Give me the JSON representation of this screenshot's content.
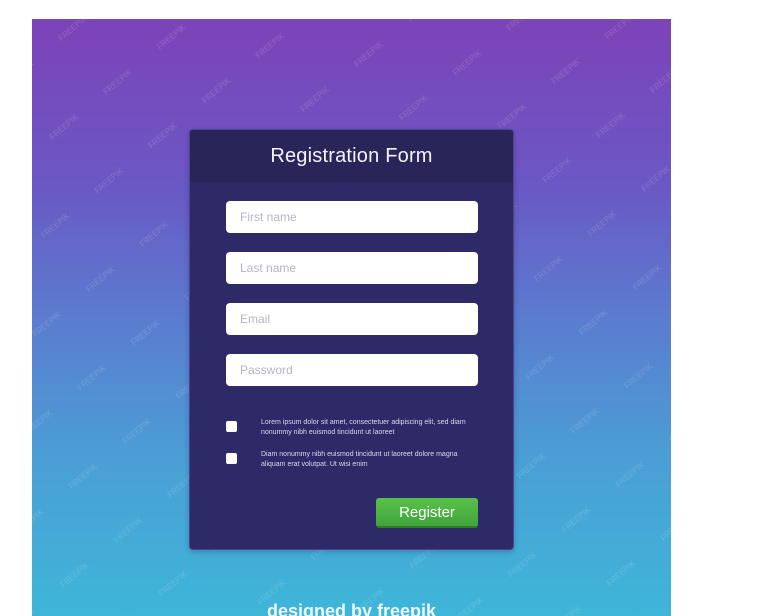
{
  "form": {
    "title": "Registration Form",
    "fields": [
      {
        "placeholder": "First name",
        "value": ""
      },
      {
        "placeholder": "Last name",
        "value": ""
      },
      {
        "placeholder": "Email",
        "value": ""
      },
      {
        "placeholder": "Password",
        "value": ""
      }
    ],
    "checkboxes": [
      {
        "checked": false,
        "text": "Lorem ipsum dolor sit amet, consectetuer adipiscing elit, sed diam nonummy nibh euismod tincidunt ut laoreet"
      },
      {
        "checked": false,
        "text": "Diam nonummy nibh euismod tincidunt ut laoreet dolore magna aliquam erat volutpat. Ut wisi enim"
      }
    ],
    "register_label": "Register"
  },
  "footer": {
    "credit": "designed by freepik"
  },
  "colors": {
    "gradient_top": "#7d43b8",
    "gradient_bottom": "#3eb6d8",
    "card_bg": "#2d2a67",
    "header_bg": "#292559",
    "button_green": "#41a53c"
  }
}
